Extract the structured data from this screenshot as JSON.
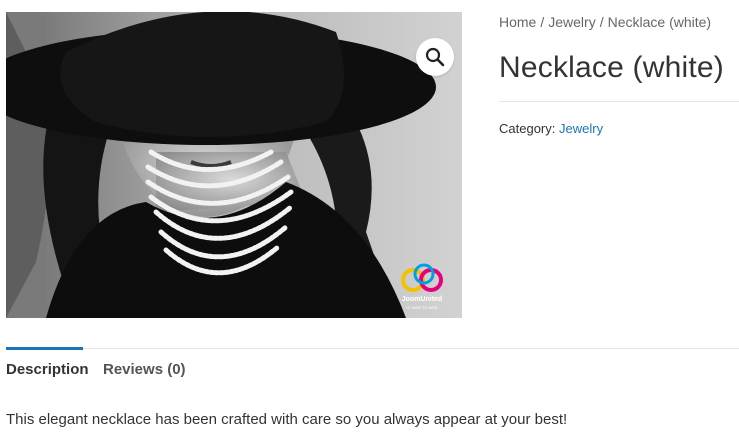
{
  "product": {
    "image_alt": "Woman in black hat wearing pearl necklace",
    "zoom_icon": "magnifier-icon",
    "logo": {
      "brand": "JoomUnited",
      "tagline": "IO WEB TO WEB"
    }
  },
  "breadcrumb": {
    "items": [
      "Home",
      "Jewelry",
      "Necklace (white)"
    ],
    "separator": "/"
  },
  "title": "Necklace (white)",
  "category": {
    "label": "Category:",
    "value": "Jewelry"
  },
  "tabs": [
    {
      "label": "Description",
      "active": true
    },
    {
      "label": "Reviews (0)",
      "active": false
    }
  ],
  "description": "This elegant necklace has been crafted with care so you always appear at your best!",
  "colors": {
    "link": "#1a74b8",
    "text": "#333333",
    "divider": "#e5e5e5"
  }
}
